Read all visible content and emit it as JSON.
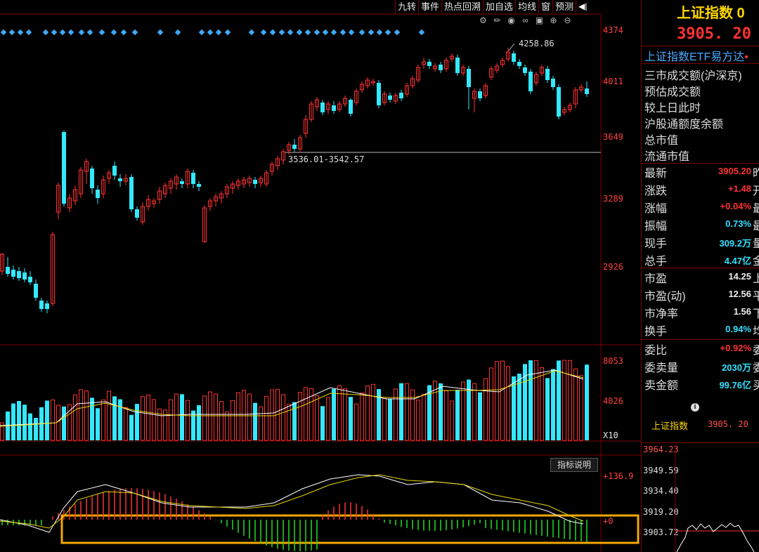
{
  "toolbar": {
    "items": [
      "九转",
      "事件",
      "热点回溯",
      "加自选",
      "均线",
      "窗",
      "预测"
    ],
    "collapse_icon": "collapse-arrow-icon"
  },
  "tool_icons": [
    "gear-icon",
    "draw-icon",
    "eye-icon",
    "link-icon",
    "camera-icon",
    "zoom-in-icon",
    "zoom-out-icon"
  ],
  "main_axis": {
    "labels": [
      "4374",
      "4011",
      "3649",
      "3289",
      "2926"
    ]
  },
  "volume_axis": {
    "labels": [
      "8053",
      "4026"
    ],
    "unit": "X10"
  },
  "macd_axis": {
    "labels": [
      "+136.9",
      "+0"
    ]
  },
  "annotations": {
    "high": "4258.86",
    "range": "3536.01-3542.57"
  },
  "indicator_button": "指标说明",
  "panel": {
    "title": "上证指数 0",
    "price": "3905. 20",
    "price_suffix": "+",
    "etf": "上证指数ETF易方达",
    "etf_mark": "•",
    "sections": [
      "三市成交额(沪深京)",
      "预估成交额",
      "较上日此时",
      "沪股通额度余额",
      "总市值",
      "流通市值"
    ],
    "rows": [
      {
        "label": "最新",
        "value": "3905.20",
        "tail": "昨",
        "color": "red"
      },
      {
        "label": "涨跌",
        "value": "+1.48",
        "tail": "开",
        "color": "red"
      },
      {
        "label": "涨幅",
        "value": "+0.04%",
        "tail": "最",
        "color": "red"
      },
      {
        "label": "振幅",
        "value": "0.73%",
        "tail": "最",
        "color": "cyan"
      },
      {
        "label": "现手",
        "value": "309.2万",
        "tail": "量",
        "color": "cyan"
      },
      {
        "label": "总手",
        "value": "4.47亿",
        "tail": "金",
        "color": "cyan"
      },
      {
        "label": "市盈",
        "value": "14.25",
        "tail": "上",
        "color": "wht"
      },
      {
        "label": "市盈(动)",
        "value": "12.56",
        "tail": "平",
        "color": "wht"
      },
      {
        "label": "市净率",
        "value": "1.56",
        "tail": "下",
        "color": "wht"
      },
      {
        "label": "换手",
        "value": "0.94%",
        "tail": "均",
        "color": "cyan"
      },
      {
        "label": "委比",
        "value": "+0.92%",
        "tail": "委",
        "color": "red"
      },
      {
        "label": "委卖量",
        "value": "2030万",
        "tail": "委",
        "color": "cyan"
      },
      {
        "label": "卖金额",
        "value": "99.76亿",
        "tail": "买",
        "color": "cyan"
      }
    ],
    "info_icon": "info-icon",
    "index_name": "上证指数",
    "index_value": "3905. 20",
    "mini_chart_labels": [
      "3964.23",
      "3949.59",
      "3934.40",
      "3919.20",
      "3903.72"
    ]
  },
  "colors": {
    "up": "#ff3232",
    "down": "#33e8ff",
    "highlight": "#f5a800",
    "ma_white": "#ffffff",
    "ma_yellow": "#e8d800"
  }
}
